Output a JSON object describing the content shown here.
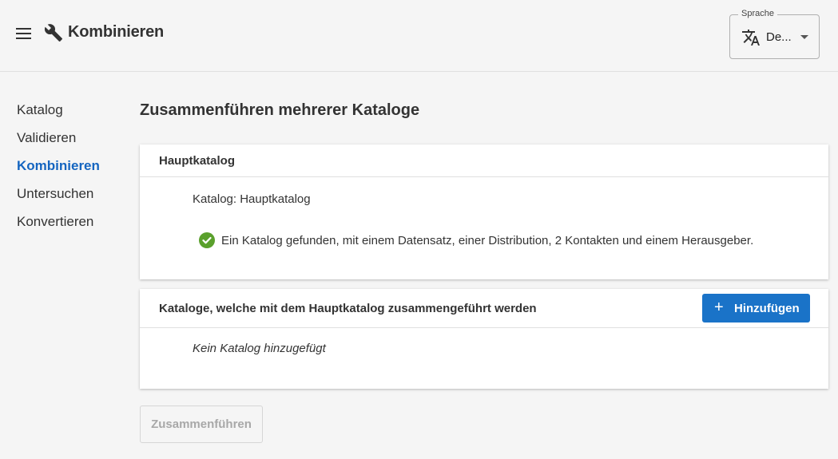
{
  "header": {
    "title": "Kombinieren",
    "language": {
      "legend": "Sprache",
      "value": "De..."
    }
  },
  "sidebar": {
    "items": [
      {
        "label": "Katalog",
        "active": false
      },
      {
        "label": "Validieren",
        "active": false
      },
      {
        "label": "Kombinieren",
        "active": true
      },
      {
        "label": "Untersuchen",
        "active": false
      },
      {
        "label": "Konvertieren",
        "active": false
      }
    ]
  },
  "main": {
    "title": "Zusammenführen mehrerer Kataloge",
    "main_catalog": {
      "heading": "Hauptkatalog",
      "catalog_label": "Katalog: Hauptkatalog",
      "status": "Ein Katalog gefunden, mit einem Datensatz, einer Distribution, 2 Kontakten und einem Herausgeber."
    },
    "merge_catalogs": {
      "heading": "Kataloge, welche mit dem Hauptkatalog zusammengeführt werden",
      "add_button": "Hinzufügen",
      "add_icon": "+",
      "empty": "Kein Katalog hinzugefügt"
    },
    "merge_button": "Zusammenführen"
  },
  "colors": {
    "accent": "#1565c0",
    "button": "#1a73c8",
    "success": "#5aa02c"
  }
}
